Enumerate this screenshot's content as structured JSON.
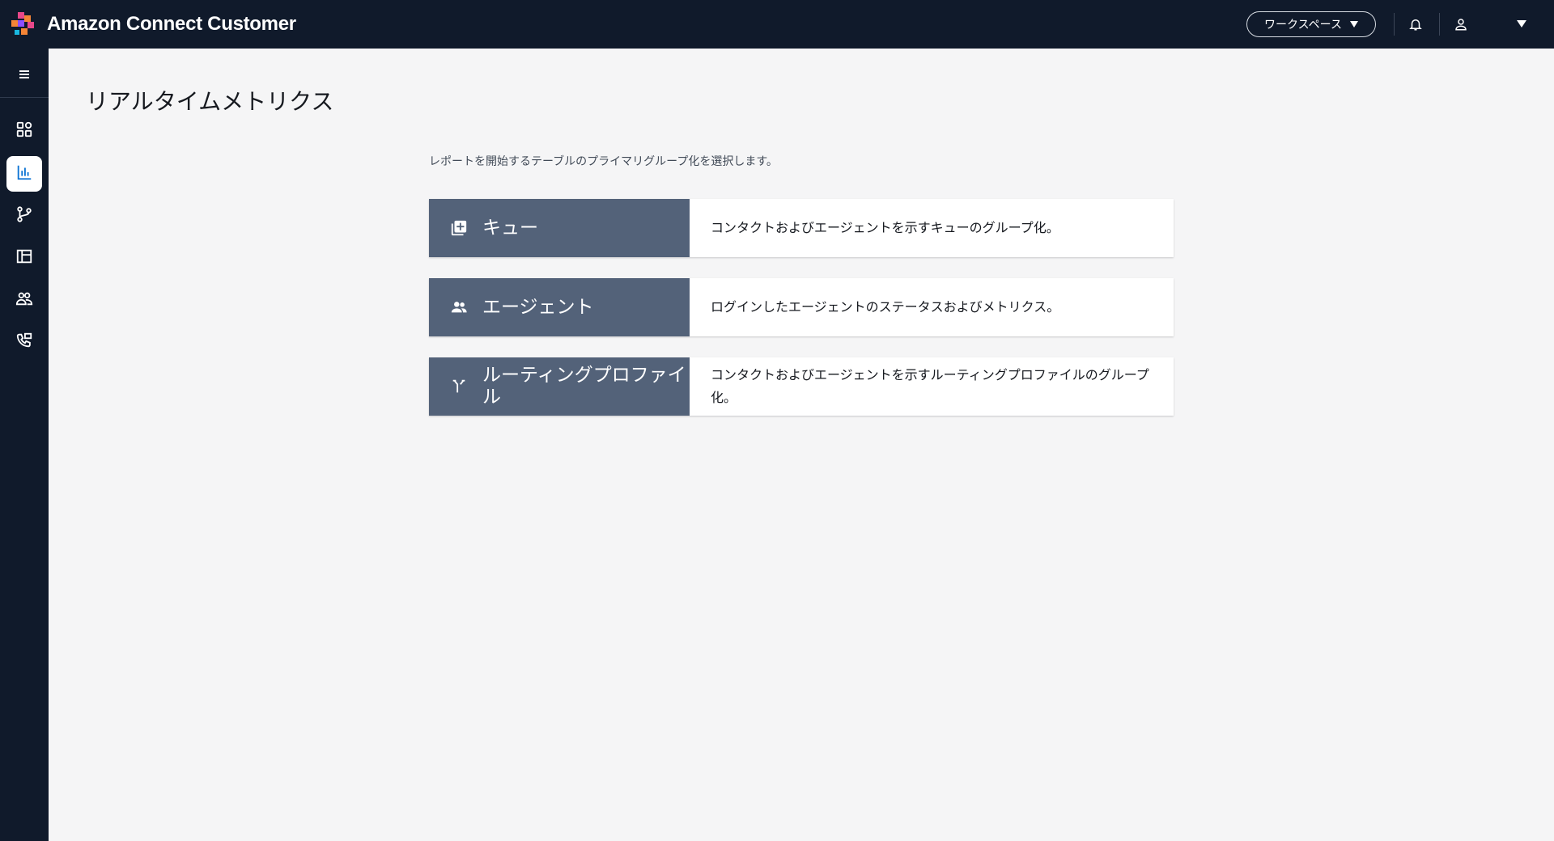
{
  "header": {
    "app_title": "Amazon Connect Customer",
    "workspace_label": "ワークスペース"
  },
  "colors": {
    "header_bg": "#101a2b",
    "card_accent": "#536279",
    "active_nav_icon": "#0972d3"
  },
  "sidebar": {
    "items": [
      {
        "icon": "dashboard-icon"
      },
      {
        "icon": "bar-chart-icon",
        "active": true
      },
      {
        "icon": "routing-icon"
      },
      {
        "icon": "table-icon"
      },
      {
        "icon": "users-icon"
      },
      {
        "icon": "phone-contact-icon"
      }
    ]
  },
  "main": {
    "page_title": "リアルタイムメトリクス",
    "instruction": "レポートを開始するテーブルのプライマリグループ化を選択します。",
    "options": [
      {
        "icon": "queue-add-icon",
        "label": "キュー",
        "description": "コンタクトおよびエージェントを示すキューのグループ化。"
      },
      {
        "icon": "agents-icon",
        "label": "エージェント",
        "description": "ログインしたエージェントのステータスおよびメトリクス。"
      },
      {
        "icon": "routing-merge-icon",
        "label": "ルーティングプロファイル",
        "description": "コンタクトおよびエージェントを示すルーティングプロファイルのグループ化。"
      }
    ]
  }
}
